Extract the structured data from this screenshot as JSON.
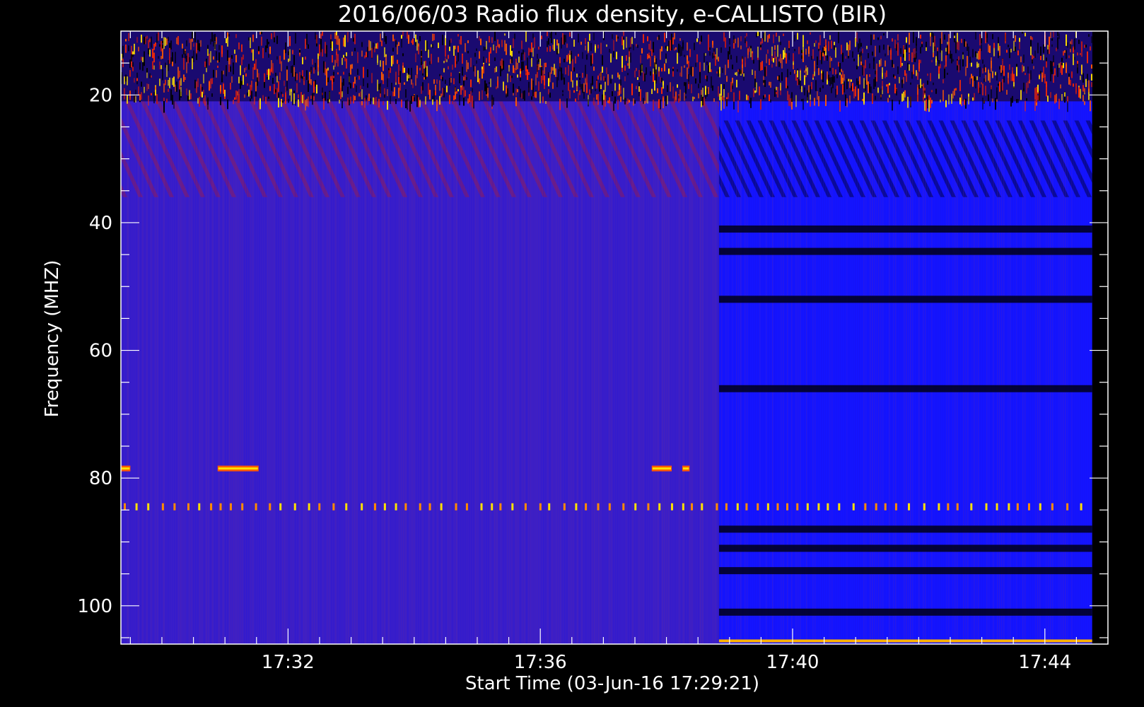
{
  "chart_data": {
    "type": "heatmap",
    "title": "2016/06/03  Radio flux density, e-CALLISTO (BIR)",
    "xlabel": "Start Time (03-Jun-16 17:29:21)",
    "ylabel": "Frequency (MHZ)",
    "x_ticks": [
      "17:32",
      "17:36",
      "17:40",
      "17:44"
    ],
    "y_ticks": [
      "20",
      "40",
      "60",
      "80",
      "100"
    ],
    "xlim": [
      "17:29:21",
      "17:45:00"
    ],
    "ylim": [
      10,
      106
    ],
    "y_inverted": true,
    "grid": false,
    "colormap": [
      "#000000",
      "#1a00ff",
      "#5028b4",
      "#c01818",
      "#ff5a00",
      "#ffe000",
      "#ffffff"
    ],
    "data_extent": {
      "t_start": "17:29:21",
      "t_end": "17:44:45",
      "f_min": 10,
      "f_max": 106
    },
    "segments": [
      {
        "t_start": "17:29:21",
        "t_end": "17:38:50",
        "background": "#3a1ec8"
      },
      {
        "t_start": "17:38:50",
        "t_end": "17:44:45",
        "background": "#1414ff"
      }
    ],
    "features": [
      {
        "kind": "noisy-band",
        "f_from": 10,
        "f_to": 21,
        "t_start": "17:29:21",
        "t_end": "17:44:45"
      },
      {
        "kind": "dark-band",
        "f": 41,
        "t_start": "17:38:50",
        "t_end": "17:44:45"
      },
      {
        "kind": "dark-band",
        "f": 44.5,
        "t_start": "17:38:50",
        "t_end": "17:44:45"
      },
      {
        "kind": "dark-band",
        "f": 52,
        "t_start": "17:38:50",
        "t_end": "17:44:45"
      },
      {
        "kind": "dark-band",
        "f": 66,
        "t_start": "17:38:50",
        "t_end": "17:44:45"
      },
      {
        "kind": "dark-band",
        "f": 88,
        "t_start": "17:38:50",
        "t_end": "17:44:45"
      },
      {
        "kind": "dark-band",
        "f": 91,
        "t_start": "17:38:50",
        "t_end": "17:44:45"
      },
      {
        "kind": "dark-band",
        "f": 94.5,
        "t_start": "17:38:50",
        "t_end": "17:44:45"
      },
      {
        "kind": "dark-band",
        "f": 101,
        "t_start": "17:38:50",
        "t_end": "17:44:45"
      },
      {
        "kind": "bright-line",
        "f": 105.5,
        "t_start": "17:38:50",
        "t_end": "17:44:45"
      },
      {
        "kind": "periodic-spikes",
        "f": 84.5,
        "t_start": "17:29:21",
        "t_end": "17:44:45"
      },
      {
        "kind": "burst",
        "f": 78.5,
        "t_start": "17:29:21",
        "t_end": "17:29:30"
      },
      {
        "kind": "burst",
        "f": 78.5,
        "t_start": "17:30:53",
        "t_end": "17:31:32"
      },
      {
        "kind": "burst",
        "f": 78.5,
        "t_start": "17:37:46",
        "t_end": "17:38:05"
      },
      {
        "kind": "burst",
        "f": 78.5,
        "t_start": "17:38:15",
        "t_end": "17:38:22"
      }
    ]
  }
}
